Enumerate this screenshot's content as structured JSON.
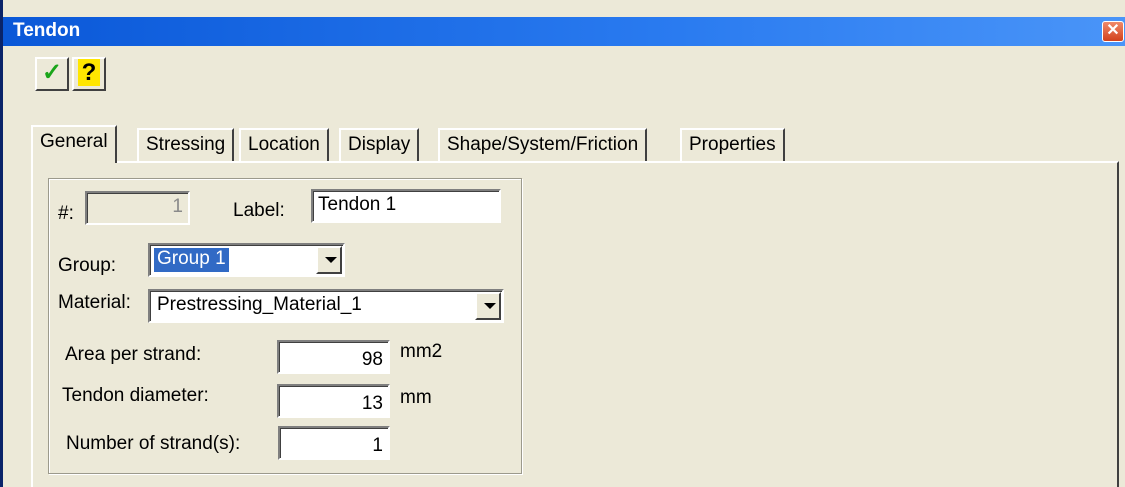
{
  "window": {
    "title": "Tendon",
    "close_glyph": "✕"
  },
  "toolbar": {
    "ok_glyph": "✓",
    "help_glyph": "?"
  },
  "tabs": [
    {
      "label": "General"
    },
    {
      "label": "Stressing"
    },
    {
      "label": "Location"
    },
    {
      "label": "Display"
    },
    {
      "label": "Shape/System/Friction"
    },
    {
      "label": "Properties"
    }
  ],
  "general": {
    "number_label": "#:",
    "number_value": "1",
    "label_label": "Label:",
    "label_value": "Tendon 1",
    "group_label": "Group:",
    "group_value": "Group 1",
    "material_label": "Material:",
    "material_value": "Prestressing_Material_1",
    "area_label": "Area per strand:",
    "area_value": "98",
    "area_unit": "mm2",
    "diameter_label": "Tendon diameter:",
    "diameter_value": "13",
    "diameter_unit": "mm",
    "strands_label": "Number of strand(s):",
    "strands_value": "1"
  }
}
